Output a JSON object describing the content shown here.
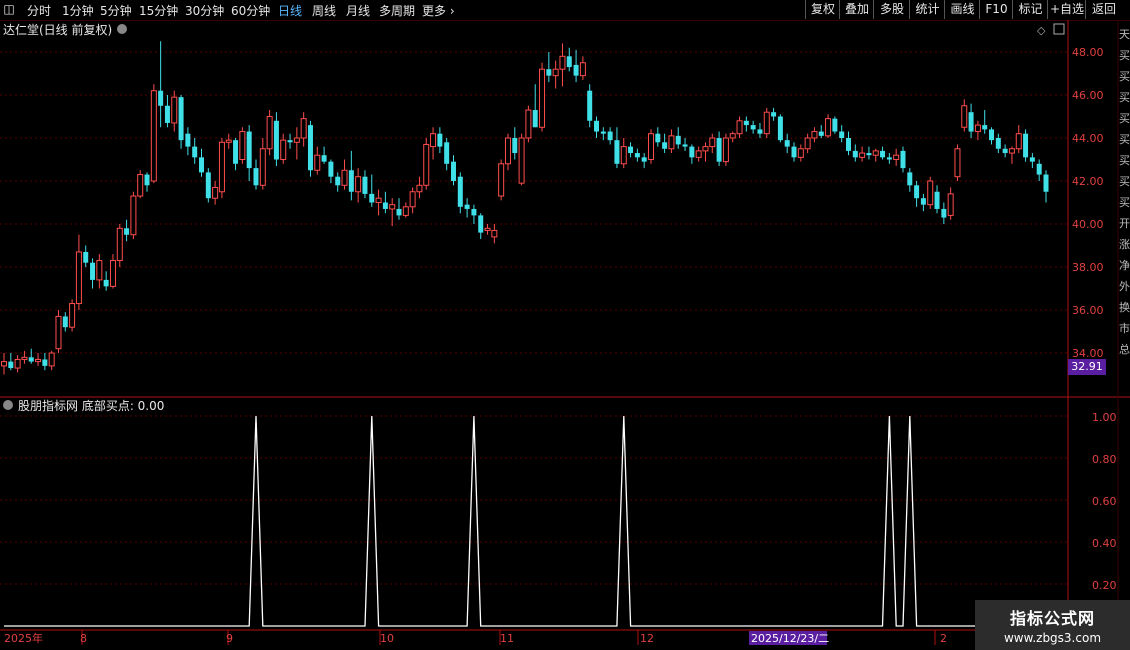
{
  "toolbar": {
    "periods": [
      "分时",
      "1分钟",
      "5分钟",
      "15分钟",
      "30分钟",
      "60分钟",
      "日线",
      "周线",
      "月线",
      "多周期",
      "更多"
    ],
    "active_period": "日线",
    "actions": [
      "复权",
      "叠加",
      "多股",
      "统计",
      "画线",
      "F10",
      "标记",
      "+自选",
      "返回"
    ]
  },
  "main": {
    "title": "达仁堂(日线 前复权)",
    "price_axis": [
      "48.00",
      "46.00",
      "44.00",
      "42.00",
      "40.00",
      "38.00",
      "36.00",
      "34.00"
    ],
    "last_price": "32.91"
  },
  "indicator": {
    "title": "股朋指标网 底部买点: 0.00",
    "axis": [
      "1.00",
      "0.80",
      "0.60",
      "0.40",
      "0.20"
    ]
  },
  "time_axis": {
    "labels": [
      "2025年",
      "8",
      "9",
      "10",
      "11",
      "12",
      "2025/12/23/二",
      "2"
    ]
  },
  "right_strip": {
    "chars": "天买买买买买买买买开涨净外换市总"
  },
  "watermark": {
    "line1": "指标公式网",
    "line2": "www.zbgs3.com"
  },
  "colors": {
    "up": "#ff4d4d",
    "down": "#3fe0e8",
    "grid": "#5a0000",
    "axis": "#b01010"
  },
  "chart_data": {
    "type": "candlestick",
    "ylim": [
      32.5,
      49.0
    ],
    "candles": [
      [
        33.4,
        34.0,
        33.0,
        33.6
      ],
      [
        33.6,
        34.0,
        33.2,
        33.3
      ],
      [
        33.3,
        33.9,
        33.1,
        33.7
      ],
      [
        33.7,
        34.1,
        33.5,
        33.8
      ],
      [
        33.8,
        34.2,
        33.5,
        33.6
      ],
      [
        33.6,
        34.0,
        33.4,
        33.7
      ],
      [
        33.7,
        34.0,
        33.2,
        33.4
      ],
      [
        33.4,
        34.1,
        33.2,
        34.0
      ],
      [
        34.2,
        36.0,
        34.0,
        35.7
      ],
      [
        35.7,
        35.9,
        35.0,
        35.2
      ],
      [
        35.2,
        36.5,
        35.0,
        36.3
      ],
      [
        36.3,
        39.5,
        36.0,
        38.7
      ],
      [
        38.7,
        39.0,
        38.0,
        38.2
      ],
      [
        38.2,
        38.4,
        37.0,
        37.4
      ],
      [
        37.4,
        38.6,
        37.0,
        38.3
      ],
      [
        37.4,
        37.8,
        36.9,
        37.1
      ],
      [
        37.1,
        38.6,
        37.0,
        38.3
      ],
      [
        38.3,
        40.0,
        38.0,
        39.8
      ],
      [
        39.8,
        40.2,
        39.2,
        39.5
      ],
      [
        39.5,
        41.5,
        39.3,
        41.3
      ],
      [
        41.3,
        42.5,
        41.2,
        42.3
      ],
      [
        42.3,
        42.4,
        41.5,
        41.8
      ],
      [
        42.0,
        46.5,
        41.9,
        46.2
      ],
      [
        46.2,
        48.5,
        44.5,
        45.5
      ],
      [
        45.5,
        46.0,
        44.5,
        44.7
      ],
      [
        44.7,
        46.2,
        44.3,
        45.9
      ],
      [
        45.9,
        46.0,
        43.5,
        43.9
      ],
      [
        44.2,
        44.5,
        43.2,
        43.6
      ],
      [
        43.6,
        44.0,
        42.8,
        43.1
      ],
      [
        43.1,
        43.5,
        42.2,
        42.4
      ],
      [
        42.4,
        42.6,
        41.0,
        41.2
      ],
      [
        41.2,
        42.0,
        40.9,
        41.7
      ],
      [
        41.5,
        44.0,
        41.2,
        43.8
      ],
      [
        43.8,
        44.2,
        43.5,
        43.9
      ],
      [
        43.9,
        44.0,
        42.5,
        42.8
      ],
      [
        43.0,
        44.5,
        42.8,
        44.3
      ],
      [
        44.3,
        44.6,
        42.0,
        42.6
      ],
      [
        42.6,
        43.0,
        41.6,
        41.8
      ],
      [
        41.8,
        44.0,
        41.6,
        43.5
      ],
      [
        43.5,
        45.3,
        43.2,
        45.0
      ],
      [
        44.8,
        45.2,
        42.7,
        43.0
      ],
      [
        43.0,
        44.2,
        42.8,
        43.9
      ],
      [
        43.9,
        44.2,
        43.5,
        43.8
      ],
      [
        43.8,
        44.5,
        43.0,
        44.0
      ],
      [
        44.0,
        45.2,
        43.6,
        44.9
      ],
      [
        44.6,
        44.8,
        42.2,
        42.5
      ],
      [
        42.5,
        43.6,
        42.3,
        43.2
      ],
      [
        43.2,
        43.6,
        42.8,
        42.9
      ],
      [
        42.9,
        43.0,
        41.9,
        42.2
      ],
      [
        42.2,
        42.4,
        41.5,
        41.8
      ],
      [
        41.8,
        43.0,
        41.6,
        42.5
      ],
      [
        42.5,
        43.4,
        41.1,
        41.5
      ],
      [
        41.5,
        42.6,
        41.0,
        42.2
      ],
      [
        42.2,
        42.5,
        41.2,
        41.4
      ],
      [
        41.4,
        42.3,
        40.8,
        41.0
      ],
      [
        41.0,
        41.6,
        40.4,
        41.2
      ],
      [
        41.0,
        41.5,
        40.5,
        40.7
      ],
      [
        40.7,
        41.2,
        39.9,
        40.9
      ],
      [
        40.7,
        41.2,
        40.2,
        40.4
      ],
      [
        40.4,
        41.0,
        40.3,
        40.8
      ],
      [
        40.8,
        41.7,
        40.5,
        41.5
      ],
      [
        41.5,
        42.2,
        41.2,
        41.8
      ],
      [
        41.8,
        44.0,
        41.6,
        43.7
      ],
      [
        43.6,
        44.5,
        43.0,
        44.2
      ],
      [
        44.2,
        44.5,
        43.3,
        43.6
      ],
      [
        43.8,
        44.0,
        42.5,
        42.8
      ],
      [
        42.9,
        43.2,
        41.8,
        42.0
      ],
      [
        42.2,
        42.4,
        40.5,
        40.8
      ],
      [
        40.9,
        41.2,
        40.3,
        40.7
      ],
      [
        40.7,
        40.9,
        40.0,
        40.4
      ],
      [
        40.4,
        40.5,
        39.3,
        39.6
      ],
      [
        39.7,
        40.0,
        39.5,
        39.8
      ],
      [
        39.4,
        40.0,
        39.1,
        39.7
      ],
      [
        41.3,
        43.0,
        41.1,
        42.8
      ],
      [
        42.8,
        44.2,
        42.5,
        44.0
      ],
      [
        44.0,
        44.5,
        43.0,
        43.3
      ],
      [
        41.9,
        44.2,
        41.8,
        44.0
      ],
      [
        44.0,
        45.5,
        43.8,
        45.3
      ],
      [
        45.3,
        46.5,
        44.5,
        44.5
      ],
      [
        44.5,
        47.5,
        44.3,
        47.2
      ],
      [
        47.2,
        48.0,
        46.6,
        46.9
      ],
      [
        46.9,
        47.6,
        46.3,
        47.2
      ],
      [
        47.2,
        48.4,
        46.4,
        47.8
      ],
      [
        47.8,
        48.2,
        47.1,
        47.3
      ],
      [
        47.4,
        48.1,
        46.6,
        46.9
      ],
      [
        46.9,
        47.8,
        46.7,
        47.5
      ],
      [
        46.2,
        46.5,
        44.5,
        44.8
      ],
      [
        44.8,
        45.0,
        44.0,
        44.3
      ],
      [
        44.3,
        44.5,
        43.9,
        44.2
      ],
      [
        44.3,
        44.5,
        43.7,
        43.9
      ],
      [
        43.9,
        44.5,
        42.6,
        42.8
      ],
      [
        42.8,
        44.0,
        42.6,
        43.6
      ],
      [
        43.6,
        43.8,
        43.1,
        43.3
      ],
      [
        43.3,
        43.5,
        42.9,
        43.1
      ],
      [
        43.1,
        43.3,
        42.6,
        42.9
      ],
      [
        43.0,
        44.4,
        42.8,
        44.2
      ],
      [
        44.2,
        44.5,
        43.6,
        43.8
      ],
      [
        43.8,
        44.2,
        43.3,
        43.5
      ],
      [
        43.5,
        44.4,
        43.3,
        44.1
      ],
      [
        44.1,
        44.5,
        43.5,
        43.7
      ],
      [
        43.7,
        44.0,
        43.4,
        43.6
      ],
      [
        43.6,
        43.7,
        42.8,
        43.1
      ],
      [
        43.1,
        43.6,
        42.9,
        43.4
      ],
      [
        43.4,
        43.8,
        42.9,
        43.6
      ],
      [
        43.6,
        44.2,
        43.3,
        44.0
      ],
      [
        44.0,
        44.3,
        42.7,
        42.9
      ],
      [
        42.9,
        44.2,
        42.7,
        44.0
      ],
      [
        44.0,
        44.3,
        43.8,
        44.2
      ],
      [
        44.2,
        45.0,
        44.0,
        44.8
      ],
      [
        44.8,
        45.0,
        44.3,
        44.6
      ],
      [
        44.6,
        44.8,
        44.2,
        44.4
      ],
      [
        44.4,
        44.7,
        44.0,
        44.2
      ],
      [
        44.2,
        45.4,
        44.0,
        45.2
      ],
      [
        45.2,
        45.4,
        44.8,
        45.0
      ],
      [
        45.0,
        45.1,
        43.8,
        43.9
      ],
      [
        43.9,
        44.2,
        43.3,
        43.6
      ],
      [
        43.6,
        43.8,
        42.9,
        43.1
      ],
      [
        43.1,
        43.7,
        42.9,
        43.5
      ],
      [
        43.5,
        44.2,
        43.3,
        44.0
      ],
      [
        44.0,
        44.5,
        43.8,
        44.3
      ],
      [
        44.3,
        44.6,
        44.0,
        44.1
      ],
      [
        44.1,
        45.1,
        44.0,
        44.9
      ],
      [
        44.9,
        45.0,
        44.2,
        44.3
      ],
      [
        44.3,
        44.6,
        43.8,
        44.0
      ],
      [
        44.0,
        44.3,
        43.2,
        43.4
      ],
      [
        43.4,
        43.7,
        42.9,
        43.1
      ],
      [
        43.1,
        43.6,
        42.9,
        43.3
      ],
      [
        43.3,
        43.6,
        43.0,
        43.2
      ],
      [
        43.2,
        43.5,
        42.9,
        43.4
      ],
      [
        43.4,
        43.6,
        43.0,
        43.1
      ],
      [
        43.1,
        43.3,
        42.8,
        43.0
      ],
      [
        43.0,
        43.5,
        42.7,
        43.2
      ],
      [
        43.4,
        43.6,
        42.4,
        42.6
      ],
      [
        42.4,
        42.6,
        41.5,
        41.8
      ],
      [
        41.8,
        42.0,
        40.8,
        41.2
      ],
      [
        41.2,
        41.4,
        40.6,
        40.9
      ],
      [
        40.9,
        42.2,
        40.7,
        42.0
      ],
      [
        41.5,
        41.8,
        40.5,
        40.7
      ],
      [
        40.7,
        41.0,
        40.0,
        40.3
      ],
      [
        40.4,
        41.7,
        40.2,
        41.4
      ],
      [
        42.2,
        43.7,
        42.0,
        43.5
      ],
      [
        44.5,
        45.8,
        44.3,
        45.5
      ],
      [
        45.2,
        45.6,
        44.0,
        44.3
      ],
      [
        44.3,
        44.8,
        43.9,
        44.6
      ],
      [
        44.6,
        45.3,
        44.2,
        44.4
      ],
      [
        44.4,
        44.5,
        43.7,
        43.9
      ],
      [
        44.0,
        44.2,
        43.3,
        43.5
      ],
      [
        43.5,
        43.7,
        43.1,
        43.3
      ],
      [
        43.3,
        43.6,
        42.8,
        43.5
      ],
      [
        43.5,
        44.6,
        43.3,
        44.2
      ],
      [
        44.2,
        44.4,
        42.9,
        43.1
      ],
      [
        43.1,
        43.3,
        42.6,
        42.9
      ],
      [
        42.8,
        43.0,
        42.0,
        42.3
      ],
      [
        42.3,
        42.5,
        41.0,
        41.5
      ]
    ],
    "indicator_peaks": [
      37,
      54,
      69,
      91,
      130,
      133
    ]
  }
}
